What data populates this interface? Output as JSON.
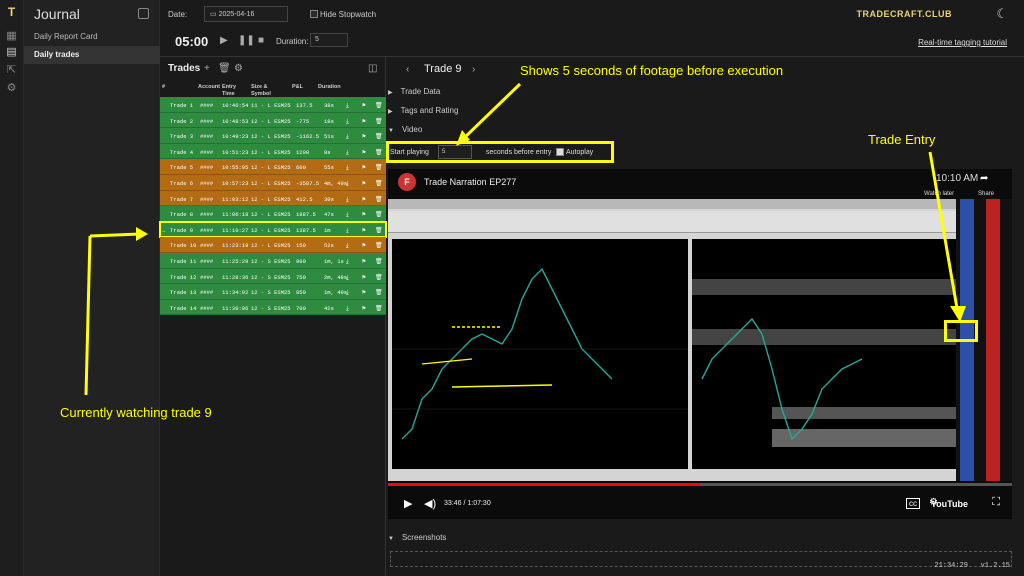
{
  "sidebar": {
    "title": "Journal",
    "items": [
      {
        "label": "Daily Report Card"
      },
      {
        "label": "Daily trades"
      }
    ]
  },
  "toolbar": {
    "date_label": "Date:",
    "date_value": "2025-04-16",
    "hide_label": "Hide Stopwatch",
    "tutorial": "Real-time tagging tutorial",
    "brand": "TRADECRAFT.CLUB"
  },
  "stopwatch": {
    "time": "05:00",
    "duration_label": "Duration:",
    "duration_value": "5"
  },
  "trades": {
    "title": "Trades",
    "headers": [
      "#",
      "Account",
      "Entry Time",
      "Size & Symbol",
      "P&L",
      "Duration"
    ],
    "rows": [
      {
        "name": "Trade 1",
        "acct": "####",
        "time": "10:46:54",
        "sym": "11 - L ESM25",
        "pnl": "137.5",
        "dur": "38s",
        "color": "green"
      },
      {
        "name": "Trade 2",
        "acct": "####",
        "time": "10:48:53",
        "sym": "12 - L ESM25",
        "pnl": "-775",
        "dur": "18s",
        "color": "green"
      },
      {
        "name": "Trade 3",
        "acct": "####",
        "time": "10:49:23",
        "sym": "12 - L ESM25",
        "pnl": "-1162.5",
        "dur": "51s",
        "color": "green"
      },
      {
        "name": "Trade 4",
        "acct": "####",
        "time": "10:51:23",
        "sym": "12 - L ESM25",
        "pnl": "1200",
        "dur": "8s",
        "color": "green"
      },
      {
        "name": "Trade 5",
        "acct": "####",
        "time": "10:55:05",
        "sym": "12 - L ESM25",
        "pnl": "600",
        "dur": "55s",
        "color": "orange"
      },
      {
        "name": "Trade 6",
        "acct": "####",
        "time": "10:57:23",
        "sym": "12 - L ESM25",
        "pnl": "-3587.5",
        "dur": "4m, 49s",
        "color": "orange"
      },
      {
        "name": "Trade 7",
        "acct": "####",
        "time": "11:03:12",
        "sym": "12 - L ESM25",
        "pnl": "412.5",
        "dur": "30s",
        "color": "orange"
      },
      {
        "name": "Trade 8",
        "acct": "####",
        "time": "11:06:18",
        "sym": "12 - L ESM25",
        "pnl": "1887.5",
        "dur": "47s",
        "color": "green"
      },
      {
        "name": "Trade 9",
        "acct": "####",
        "time": "11:10:27",
        "sym": "12 - L ESM25",
        "pnl": "1387.5",
        "dur": "1m",
        "color": "green"
      },
      {
        "name": "Trade 10",
        "acct": "####",
        "time": "11:23:19",
        "sym": "12 - L ESM25",
        "pnl": "150",
        "dur": "52s",
        "color": "orange"
      },
      {
        "name": "Trade 11",
        "acct": "####",
        "time": "11:25:29",
        "sym": "12 - S ESM25",
        "pnl": "900",
        "dur": "1m, 1s",
        "color": "green"
      },
      {
        "name": "Trade 12",
        "acct": "####",
        "time": "11:28:36",
        "sym": "12 - S ESM25",
        "pnl": "750",
        "dur": "2m, 48s",
        "color": "green"
      },
      {
        "name": "Trade 13",
        "acct": "####",
        "time": "11:34:02",
        "sym": "12 - S ESM25",
        "pnl": "850",
        "dur": "1m, 49s",
        "color": "green"
      },
      {
        "name": "Trade 14",
        "acct": "####",
        "time": "11:39:06",
        "sym": "12 - S ESM25",
        "pnl": "700",
        "dur": "42s",
        "color": "green"
      }
    ]
  },
  "detail": {
    "title": "Trade 9",
    "sections": [
      "Trade Data",
      "Tags and Rating",
      "Video",
      "Screenshots"
    ],
    "start_playing_label": "Start playing",
    "start_playing_value": "5",
    "seconds_label": "seconds before entry",
    "autoplay_label": "Autoplay"
  },
  "video": {
    "title": "Trade Narration EP277",
    "avatar_letter": "F",
    "time": "33:46 / 1:07:30",
    "clock": "10:10 AM",
    "watch_later": "Watch later",
    "share": "Share",
    "youtube": "YouTube",
    "progress": 0.5
  },
  "annotations": {
    "top": "Shows 5 seconds of footage before execution",
    "entry": "Trade Entry",
    "watching": "Currently watching trade 9"
  },
  "status": {
    "clock": "21:34:29",
    "version": "v1.2.15"
  }
}
